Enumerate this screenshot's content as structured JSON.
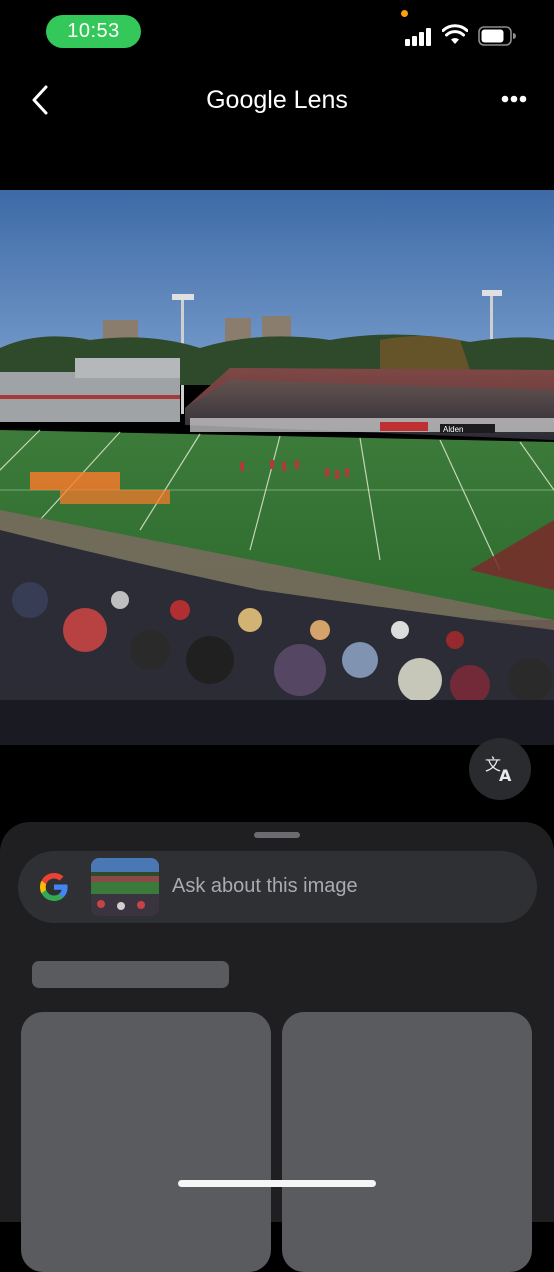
{
  "status": {
    "time": "10:53",
    "colors": {
      "time_pill": "#34c759",
      "privacy_dot": "#ff9f0a"
    },
    "icons": [
      "cellular-signal-icon",
      "wifi-icon",
      "battery-icon"
    ]
  },
  "header": {
    "title": "Google Lens",
    "back_icon": "chevron-left-icon",
    "more_icon": "more-horizontal-icon"
  },
  "photo": {
    "description_icon": "photo",
    "jumbotron_text": "Alden"
  },
  "translate_button": {
    "icon": "translate-icon"
  },
  "sheet": {
    "search": {
      "placeholder": "Ask about this image",
      "logo": "google-g-icon"
    }
  }
}
